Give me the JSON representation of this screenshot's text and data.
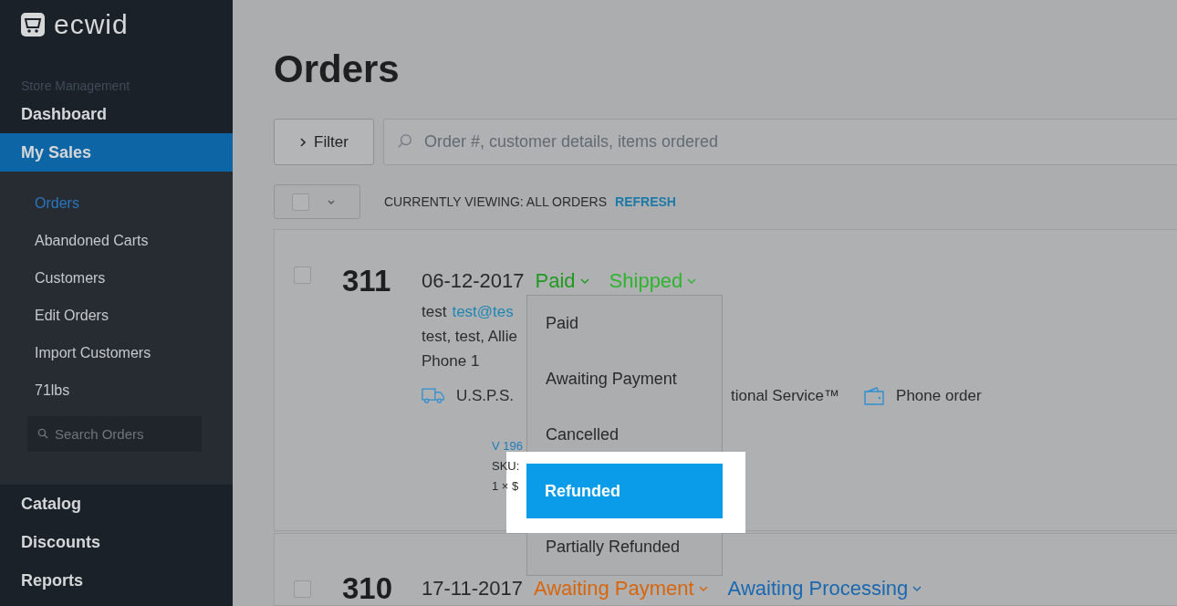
{
  "brand": {
    "name": "ecwid"
  },
  "sidebar": {
    "section_label": "Store Management",
    "items": [
      {
        "label": "Dashboard",
        "selected": false
      },
      {
        "label": "My Sales",
        "selected": true,
        "children": [
          {
            "label": "Orders",
            "selected": true
          },
          {
            "label": "Abandoned Carts",
            "selected": false
          },
          {
            "label": "Customers",
            "selected": false
          },
          {
            "label": "Edit Orders",
            "selected": false
          },
          {
            "label": "Import Customers",
            "selected": false
          },
          {
            "label": "71lbs",
            "selected": false
          }
        ],
        "search": {
          "placeholder": "Search Orders"
        }
      },
      {
        "label": "Catalog",
        "selected": false
      },
      {
        "label": "Discounts",
        "selected": false
      },
      {
        "label": "Reports",
        "selected": false
      }
    ]
  },
  "page": {
    "title": "Orders"
  },
  "toolbar": {
    "filter_button": "Filter",
    "search": {
      "placeholder": "Order #, customer details, items ordered"
    }
  },
  "view_bar": {
    "select_all_checked": false,
    "label": "CURRENTLY VIEWING: ALL ORDERS",
    "refresh_link": "REFRESH"
  },
  "orders": [
    {
      "number": "311",
      "checked": false,
      "date": "06-12-2017",
      "payment_status": {
        "label": "Paid",
        "color": "#1f9a1f"
      },
      "fulfillment_status": {
        "label": "Shipped",
        "color": "#2db52d"
      },
      "customer_name": "test",
      "customer_email": "test@tes",
      "address": "test, test, Allie",
      "phone": "Phone 1",
      "shipping_method": "U.S.P.S.",
      "shipping_method_tail": "tional Service™",
      "order_source": "Phone order",
      "item_name": "V 196",
      "item_sku": "SKU:",
      "item_qty": "1 × $"
    },
    {
      "number": "310",
      "checked": false,
      "date": "17-11-2017",
      "payment_status": {
        "label": "Awaiting Payment",
        "color": "#d8650a"
      },
      "fulfillment_status": {
        "label": "Awaiting Processing",
        "color": "#1a68b0"
      }
    }
  ],
  "payment_status_menu": {
    "items": [
      {
        "label": "Paid",
        "selected": false
      },
      {
        "label": "Awaiting Payment",
        "selected": false
      },
      {
        "label": "Cancelled",
        "selected": false
      },
      {
        "label": "Refunded",
        "selected": true
      },
      {
        "label": "Partially Refunded",
        "selected": false
      }
    ]
  }
}
